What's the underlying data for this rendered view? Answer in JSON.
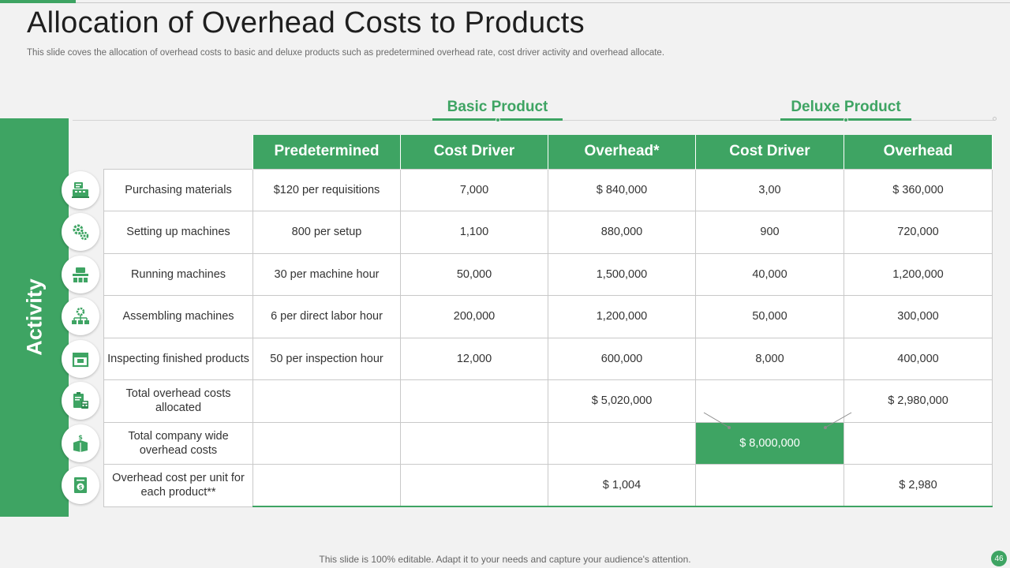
{
  "slide": {
    "title": "Allocation of Overhead Costs to Products",
    "subtitle": "This slide coves the allocation of overhead costs to basic and deluxe products such as predetermined overhead rate, cost driver activity  and overhead allocate.",
    "footer": "This slide is 100% editable. Adapt it to your needs and capture your audience's attention.",
    "page_number": "46",
    "accent_color": "#3ea463"
  },
  "groups": {
    "basic": "Basic Product",
    "deluxe": "Deluxe Product"
  },
  "sidebar": {
    "label": "Activity"
  },
  "table": {
    "columns": [
      "Predetermined",
      "Cost Driver",
      "Overhead*",
      "Cost Driver",
      "Overhead"
    ],
    "rows": [
      {
        "activity": "Purchasing materials",
        "icon": "purchase-register-icon",
        "cells": [
          "$120 per requisitions",
          "7,000",
          "$ 840,000",
          "3,00",
          "$ 360,000"
        ]
      },
      {
        "activity": "Setting up machines",
        "icon": "gears-icon",
        "cells": [
          "800 per setup",
          "1,100",
          "880,000",
          "900",
          "720,000"
        ]
      },
      {
        "activity": "Running machines",
        "icon": "conveyor-machine-icon",
        "cells": [
          "30 per machine hour",
          "50,000",
          "1,500,000",
          "40,000",
          "1,200,000"
        ]
      },
      {
        "activity": "Assembling machines",
        "icon": "gear-hierarchy-icon",
        "cells": [
          "6 per direct labor hour",
          "200,000",
          "1,200,000",
          "50,000",
          "300,000"
        ]
      },
      {
        "activity": "Inspecting finished products",
        "icon": "inspection-box-icon",
        "cells": [
          "50 per inspection hour",
          "12,000",
          "600,000",
          "8,000",
          "400,000"
        ]
      },
      {
        "activity": "Total overhead costs allocated",
        "icon": "clipboard-calculator-icon",
        "cells": [
          "",
          "",
          "$ 5,020,000",
          "",
          "$ 2,980,000"
        ]
      },
      {
        "activity": "Total company wide overhead costs",
        "icon": "money-box-icon",
        "cells": [
          "",
          "",
          "",
          "$ 8,000,000",
          ""
        ]
      },
      {
        "activity": "Overhead cost per unit for each product**",
        "icon": "dollar-document-icon",
        "cells": [
          "",
          "",
          "$ 1,004",
          "",
          "$ 2,980"
        ]
      }
    ]
  }
}
